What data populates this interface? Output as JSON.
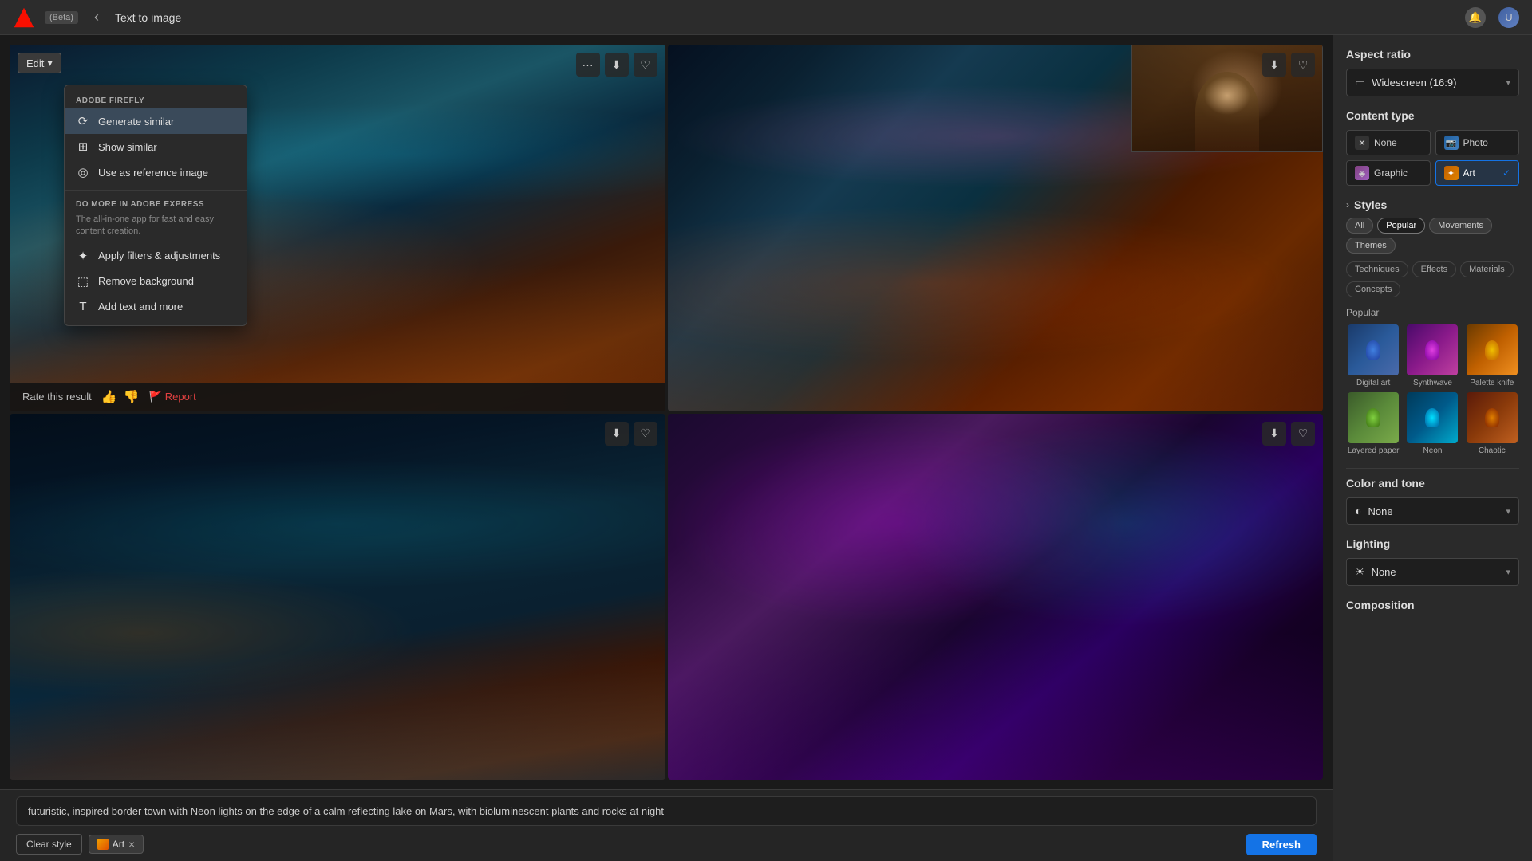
{
  "topbar": {
    "logo_alt": "Adobe logo",
    "beta_label": "(Beta)",
    "back_title": "Back",
    "title": "Text to image",
    "bell_icon": "🔔",
    "user_icon": "👤"
  },
  "context_menu": {
    "adobe_firefly_label": "ADOBE FIREFLY",
    "generate_similar": "Generate similar",
    "show_similar": "Show similar",
    "use_reference": "Use as reference image",
    "express_label": "DO MORE IN ADOBE EXPRESS",
    "express_description": "The all-in-one app for fast and easy content creation.",
    "apply_filters": "Apply filters & adjustments",
    "remove_background": "Remove background",
    "add_text": "Add text and more"
  },
  "images": {
    "edit_button": "Edit",
    "rate_label": "Rate this result",
    "report_label": "Report"
  },
  "right_sidebar": {
    "aspect_ratio": {
      "title": "Aspect ratio",
      "value": "Widescreen (16:9)"
    },
    "content_type": {
      "title": "Content type",
      "options": [
        "None",
        "Photo",
        "Graphic",
        "Art"
      ]
    },
    "styles": {
      "title": "Styles",
      "tabs": [
        "All",
        "Popular",
        "Movements",
        "Themes"
      ],
      "subtabs": [
        "Techniques",
        "Effects",
        "Materials",
        "Concepts"
      ],
      "active_tab": "Popular",
      "popular_label": "Popular",
      "items_row1": [
        {
          "label": "Digital art",
          "class": "style-digital-art"
        },
        {
          "label": "Synthwave",
          "class": "style-synthwave"
        },
        {
          "label": "Palette knife",
          "class": "style-palette-knife"
        }
      ],
      "items_row2": [
        {
          "label": "Layered paper",
          "class": "style-layered-paper"
        },
        {
          "label": "Neon",
          "class": "style-neon"
        },
        {
          "label": "Chaotic",
          "class": "style-chaotic"
        }
      ]
    },
    "color_tone": {
      "title": "Color and tone",
      "value": "None"
    },
    "lighting": {
      "title": "Lighting",
      "value": "None"
    },
    "composition": {
      "title": "Composition"
    }
  },
  "prompt": {
    "text": "futuristic, inspired border town with Neon lights on the edge of a calm reflecting lake on Mars, with bioluminescent plants and rocks at night",
    "clear_style_label": "Clear style",
    "tag_label": "Art",
    "refresh_label": "Refresh"
  }
}
